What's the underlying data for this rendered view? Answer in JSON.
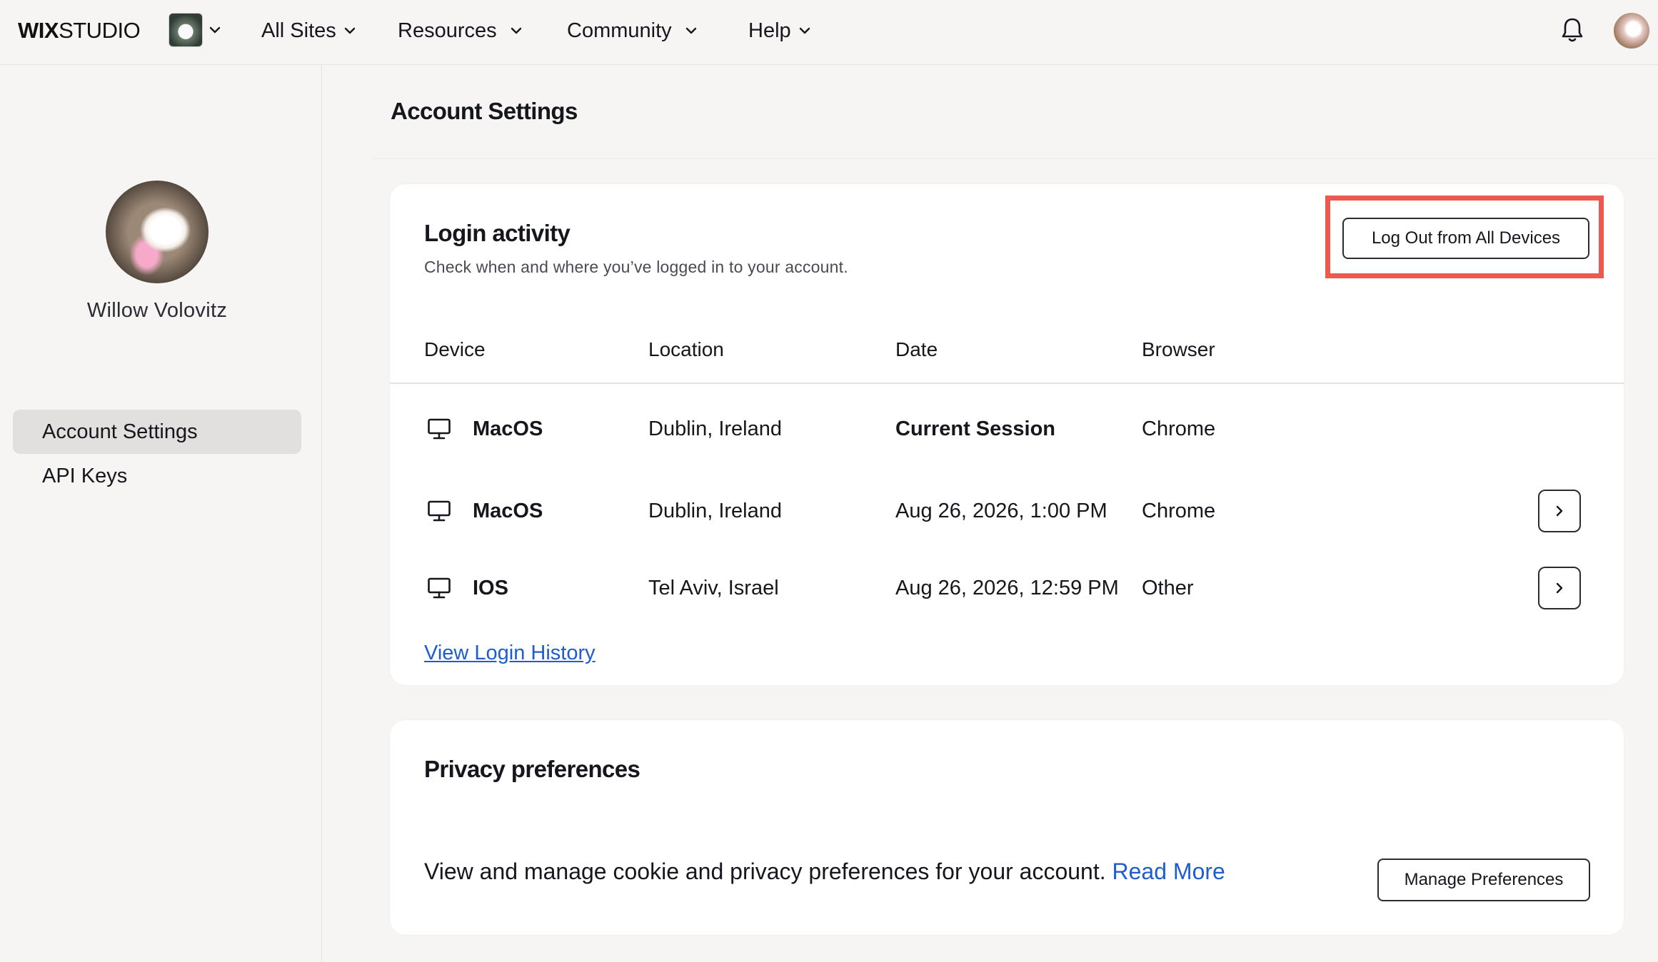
{
  "topbar": {
    "logo_bold": "WIX",
    "logo_regular": "STUDIO",
    "nav": [
      {
        "label": "All Sites"
      },
      {
        "label": "Resources"
      },
      {
        "label": "Community"
      },
      {
        "label": "Help"
      }
    ],
    "icons": {
      "site_thumbnail": "site-thumbnail",
      "notifications": "bell-icon",
      "user_avatar": "avatar"
    }
  },
  "sidebar": {
    "profile_name": "Willow Volovitz",
    "items": [
      {
        "label": "Account Settings",
        "active": true
      },
      {
        "label": "API Keys",
        "active": false
      }
    ]
  },
  "main": {
    "page_title": "Account Settings",
    "login_activity": {
      "title": "Login activity",
      "subtitle": "Check when and where you’ve logged in to your account.",
      "logout_all_label": "Log Out from All Devices",
      "columns": [
        "Device",
        "Location",
        "Date",
        "Browser"
      ],
      "rows": [
        {
          "device": "MacOS",
          "location": "Dublin, Ireland",
          "date": "Current Session",
          "browser": "Chrome",
          "current": true
        },
        {
          "device": "MacOS",
          "location": "Dublin, Ireland",
          "date": "Aug 26, 2026, 1:00 PM",
          "browser": "Chrome",
          "current": false
        },
        {
          "device": "IOS",
          "location": "Tel Aviv, Israel",
          "date": "Aug 26, 2026, 12:59 PM",
          "browser": "Other",
          "current": false
        }
      ],
      "view_history_label": "View Login History"
    },
    "privacy": {
      "title": "Privacy preferences",
      "text": "View and manage cookie and privacy preferences for your account.",
      "read_more_label": "Read More",
      "manage_label": "Manage Preferences"
    }
  },
  "colors": {
    "accent_link": "#1f5ccf",
    "highlight": "#ec5a4f",
    "background": "#f6f5f4",
    "card": "#ffffff"
  }
}
